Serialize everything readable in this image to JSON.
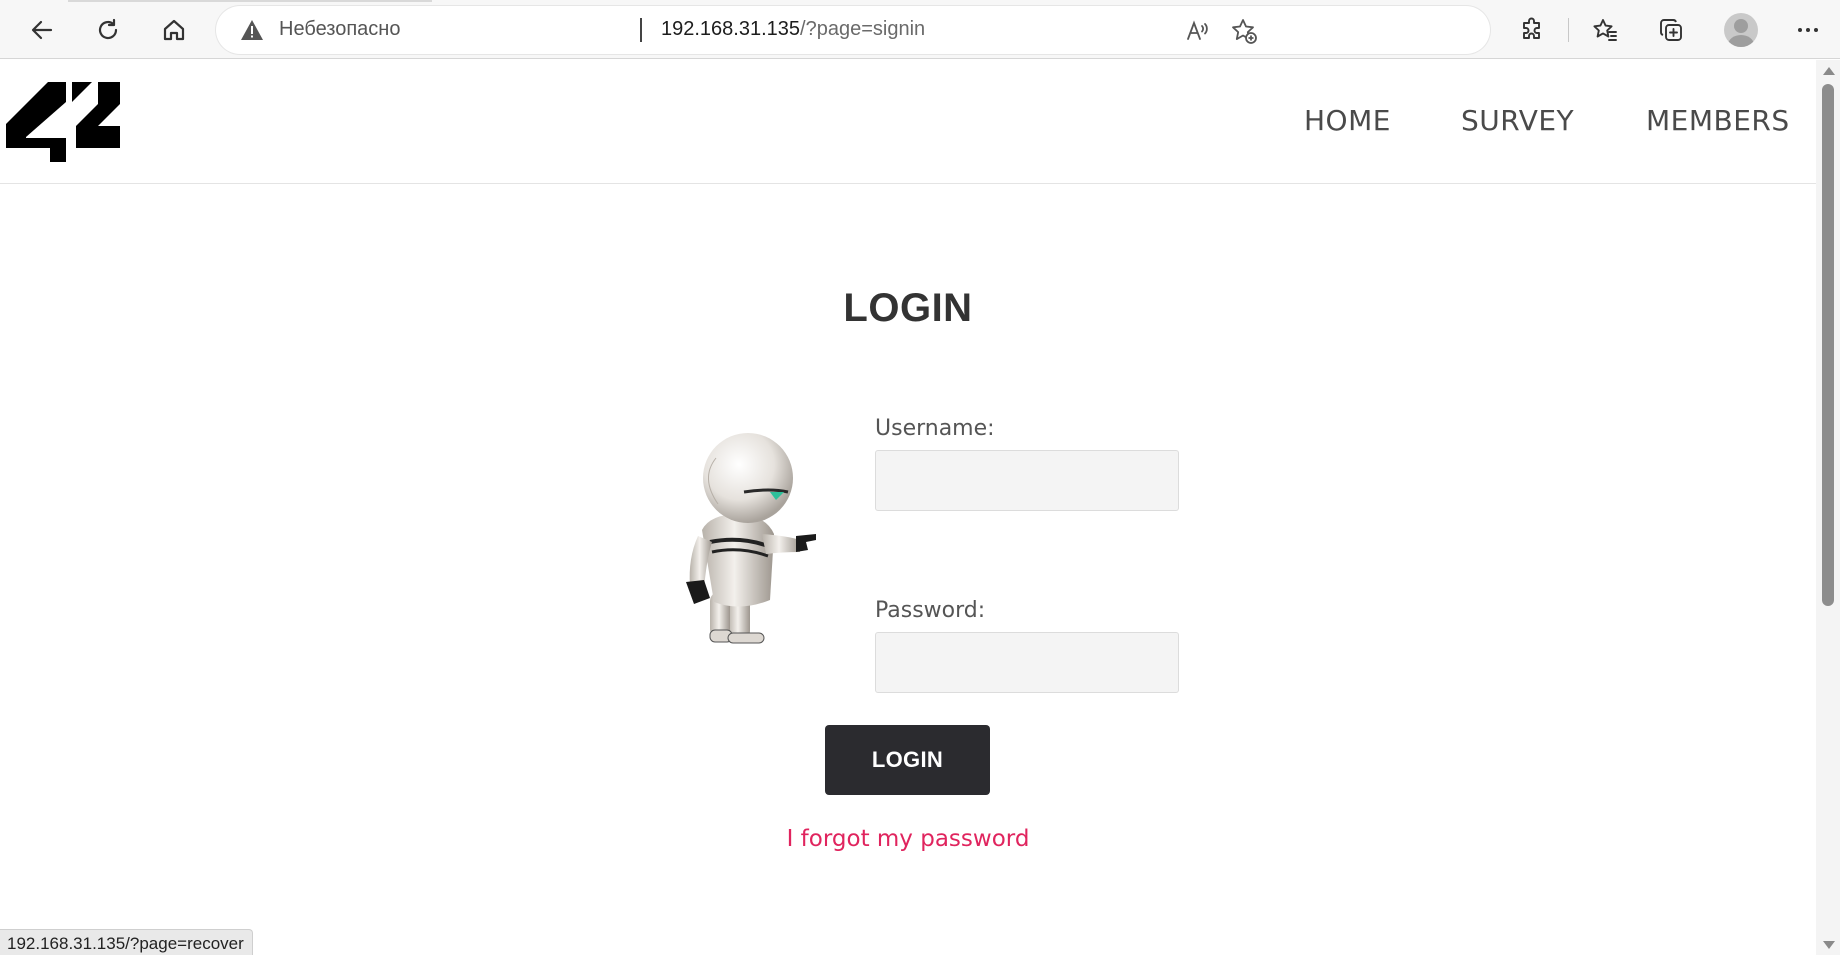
{
  "browser": {
    "security_label": "Небезопасно",
    "url_host": "192.168.31.135",
    "url_path": "/?page=signin",
    "status_url": "192.168.31.135/?page=recover",
    "icons": [
      "back-icon",
      "refresh-icon",
      "home-icon",
      "warning-icon",
      "read-aloud-icon",
      "add-favorite-icon",
      "extensions-icon",
      "favorites-icon",
      "collections-icon",
      "profile-icon",
      "more-icon"
    ]
  },
  "site": {
    "logo_text": "42",
    "nav": {
      "home": "HOME",
      "survey": "SURVEY",
      "members": "MEMBERS"
    },
    "nav_color": "#4a4a4a"
  },
  "login": {
    "title": "LOGIN",
    "username_label": "Username:",
    "username_value": "",
    "password_label": "Password:",
    "password_value": "",
    "button_label": "LOGIN",
    "forgot_link": "I forgot my password",
    "button_color": "#2b2b2f",
    "link_color": "#e0245e"
  }
}
